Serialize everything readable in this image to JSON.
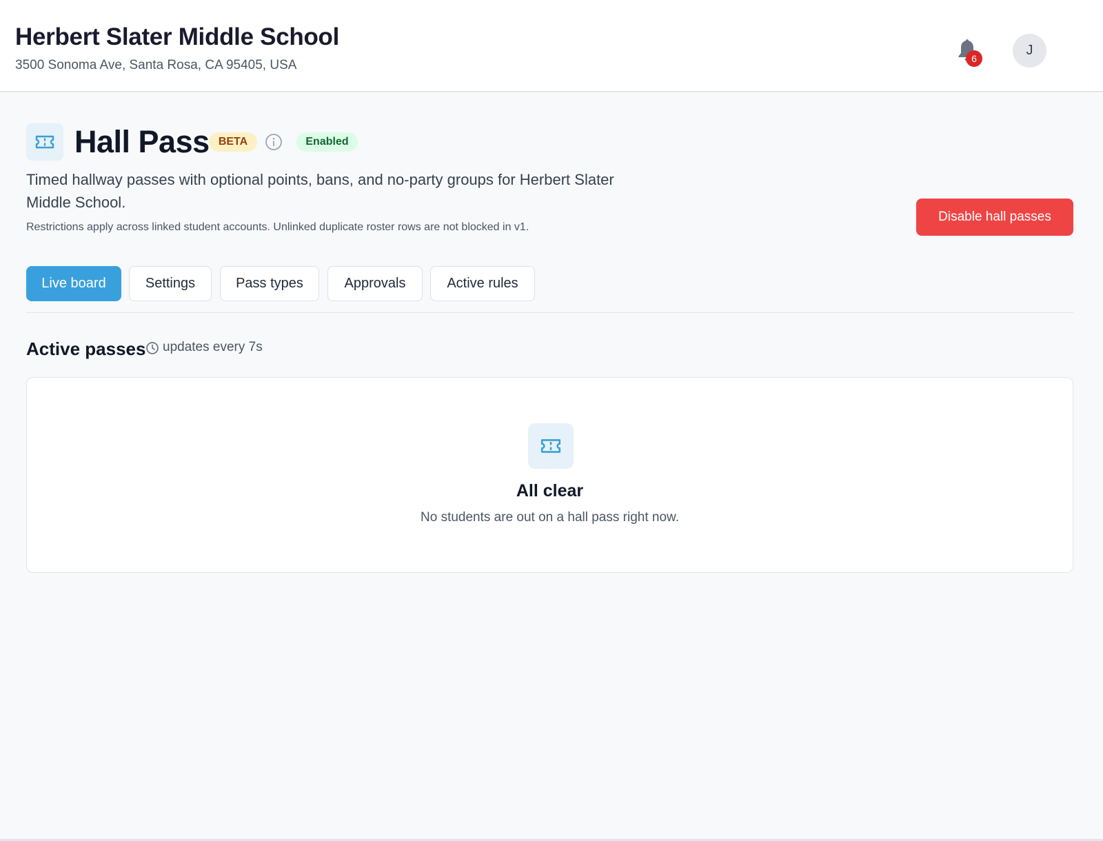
{
  "header": {
    "school_name": "Herbert Slater Middle School",
    "school_address": "3500 Sonoma Ave, Santa Rosa, CA 95405, USA",
    "notification_count": "6",
    "avatar_initial": "J"
  },
  "feature": {
    "icon": "ticket-icon",
    "title": "Hall Pass",
    "beta_label": "BETA",
    "status_label": "Enabled",
    "description": "Timed hallway passes with optional points, bans, and no-party groups for Herbert Slater Middle School.",
    "restriction_note": "Restrictions apply across linked student accounts. Unlinked duplicate roster rows are not blocked in v1.",
    "disable_button": "Disable hall passes"
  },
  "tabs": [
    {
      "label": "Live board",
      "active": true
    },
    {
      "label": "Settings",
      "active": false
    },
    {
      "label": "Pass types",
      "active": false
    },
    {
      "label": "Approvals",
      "active": false
    },
    {
      "label": "Active rules",
      "active": false
    }
  ],
  "active_passes": {
    "title": "Active passes",
    "update_note": "updates every 7s",
    "empty_title": "All clear",
    "empty_message": "No students are out on a hall pass right now."
  },
  "colors": {
    "accent": "#3aa0dd",
    "danger": "#ef4444",
    "beta_bg": "#fdf0c4",
    "enabled_bg": "#dcfce7",
    "badge_red": "#dc2626"
  }
}
